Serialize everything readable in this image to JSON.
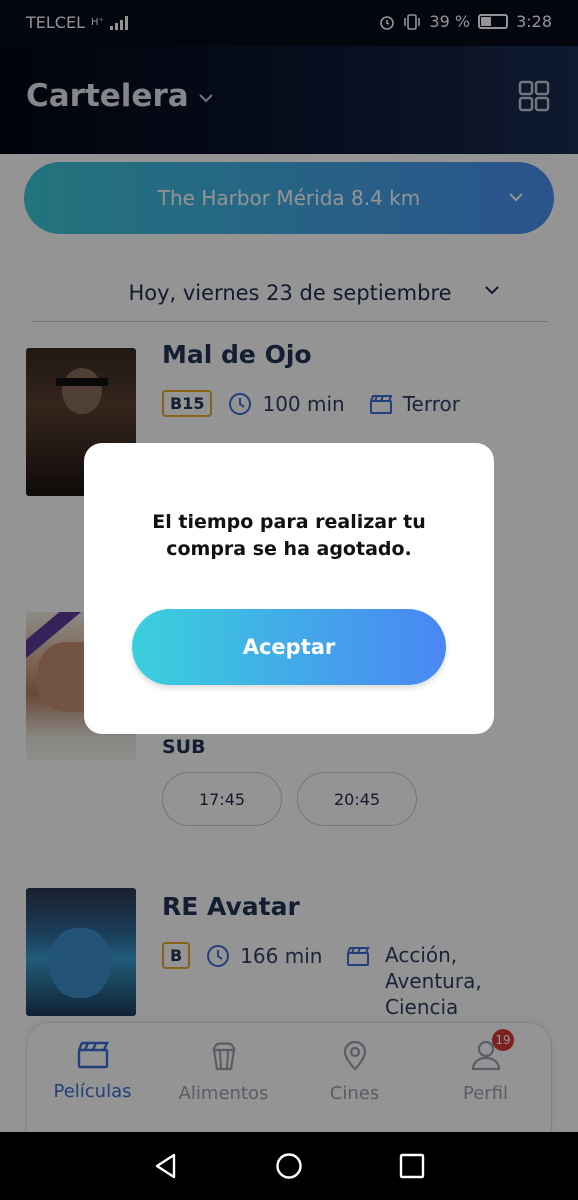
{
  "status_bar": {
    "carrier": "TELCEL",
    "network": "H⁺",
    "battery_percent": "39 %",
    "time": "3:28"
  },
  "header": {
    "title": "Cartelera"
  },
  "cinema_selector": {
    "label": "The Harbor Mérida 8.4 km"
  },
  "date_selector": {
    "label": "Hoy, viernes 23 de septiembre"
  },
  "movies": [
    {
      "title": "Mal de Ojo",
      "rating": "B15",
      "duration": "100 min",
      "genre": "Terror"
    },
    {
      "format": "SUB",
      "showtimes": [
        "17:45",
        "20:45"
      ]
    },
    {
      "title": "RE Avatar",
      "rating": "B",
      "duration": "166 min",
      "genres": [
        "Acción,",
        "Aventura,",
        "Ciencia"
      ]
    }
  ],
  "bottom_nav": {
    "items": [
      {
        "label": "Películas",
        "icon": "clapperboard-icon",
        "active": true
      },
      {
        "label": "Alimentos",
        "icon": "popcorn-icon",
        "active": false
      },
      {
        "label": "Cines",
        "icon": "location-pin-icon",
        "active": false
      },
      {
        "label": "Perfil",
        "icon": "user-icon",
        "active": false,
        "badge": "19"
      }
    ]
  },
  "dialog": {
    "message": "El tiempo para realizar tu compra se ha agotado.",
    "button_label": "Aceptar"
  },
  "colors": {
    "accent_start": "#3ad0dc",
    "accent_end": "#4a86f4",
    "header_bg": "#0c1733",
    "rating_border": "#e8a72a",
    "badge": "#d83a3a"
  }
}
